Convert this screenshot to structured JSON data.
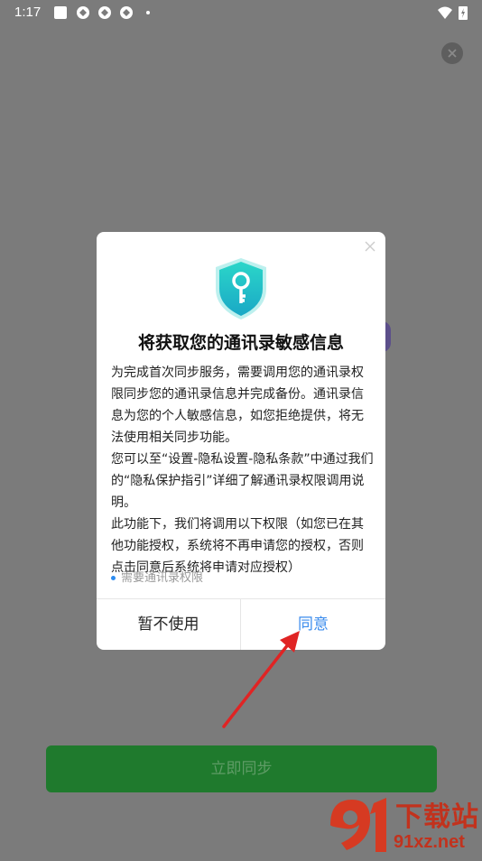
{
  "status_bar": {
    "time": "1:17"
  },
  "dialog": {
    "title": "将获取您的通讯录敏感信息",
    "body": [
      "为完成首次同步服务，需要调用您的通讯录权限同步您的通讯录信息并完成备份。通讯录信息为您的个人敏感信息，如您拒绝提供，将无法使用相关同步功能。",
      "您可以至“设置-隐私设置-隐私条款”中通过我们的“隐私保护指引”详细了解通讯录权限调用说明。",
      "此功能下，我们将调用以下权限（如您已在其他功能授权，系统将不再申请您的授权，否则点击同意后系统将申请对应授权）"
    ],
    "permission": "需要通讯录权限",
    "cancel_label": "暂不使用",
    "agree_label": "同意"
  },
  "main": {
    "sync_label": "立即同步"
  },
  "watermark": {
    "text1": "下载站",
    "text2": "91xz.net"
  },
  "colors": {
    "accent": "#3b8ced",
    "sync": "#1f7a2d",
    "shield": "#1cc2c8",
    "arrow": "#e02424"
  }
}
